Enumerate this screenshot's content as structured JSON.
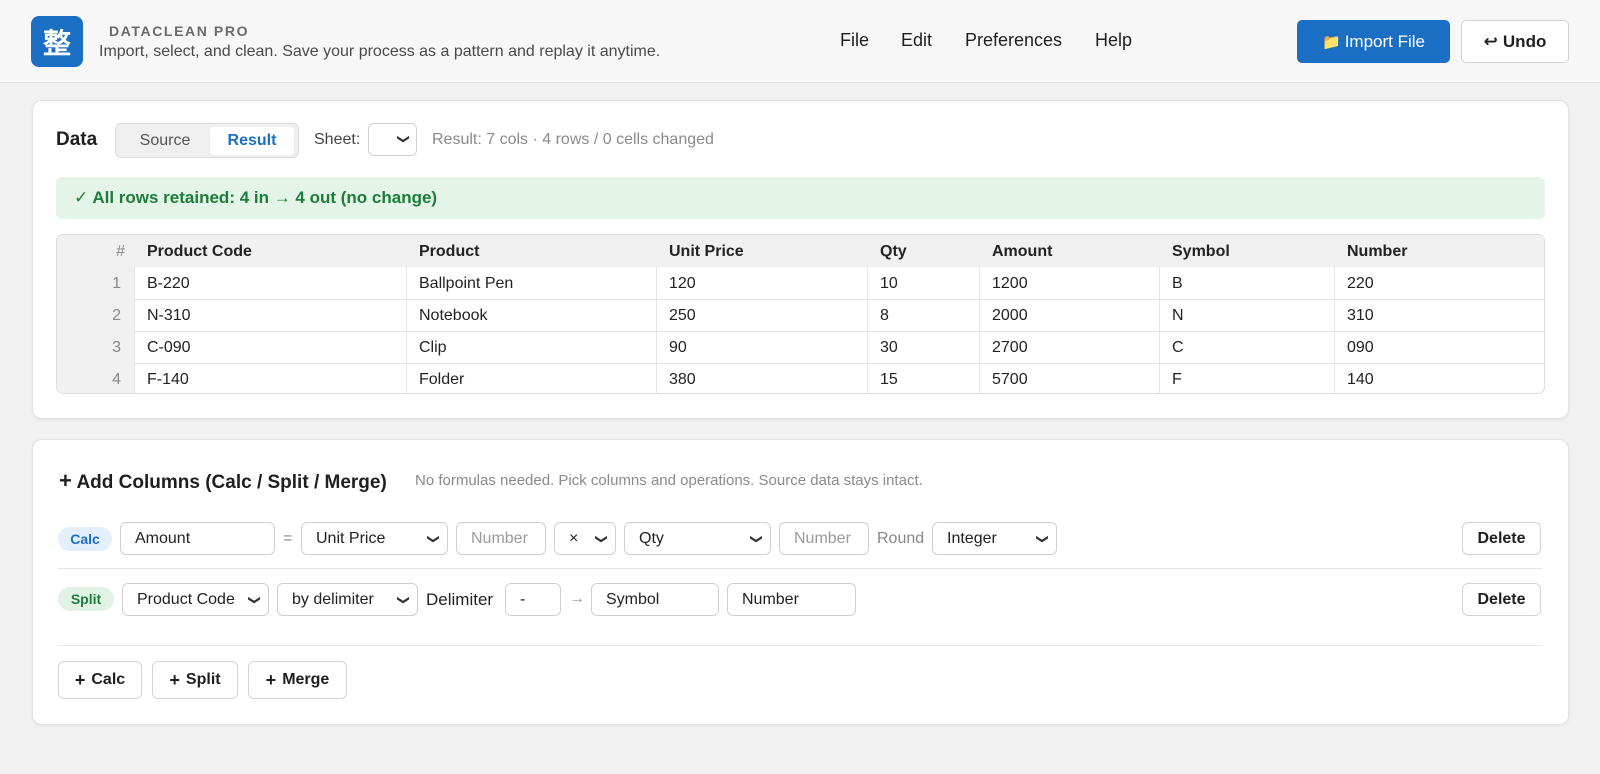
{
  "header": {
    "logo_glyph": "整",
    "brand": "DATACLEAN PRO",
    "tagline": "Import, select, and clean. Save your process as a pattern and replay it anytime.",
    "menu": {
      "file": "File",
      "edit": "Edit",
      "preferences": "Preferences",
      "help": "Help"
    },
    "import_icon": "📁",
    "import_label": "Import File",
    "undo_icon": "↩",
    "undo_label": "Undo",
    "accent_color": "#1a6fc4"
  },
  "data_panel": {
    "title": "Data",
    "view_tabs": {
      "source": "Source",
      "result": "Result",
      "active": "Result"
    },
    "sheet_label": "Sheet:",
    "sheet_value": "",
    "result_info": "Result: 7 cols · 4 rows / 0 cells changed",
    "banner": "✓ All rows retained: 4 in → 4 out (no change)",
    "table": {
      "columns": [
        "#",
        "Product Code",
        "Product",
        "Unit Price",
        "Qty",
        "Amount",
        "Symbol",
        "Number"
      ],
      "rows": [
        [
          "1",
          "B-220",
          "Ballpoint Pen",
          "120",
          "10",
          "1200",
          "B",
          "220"
        ],
        [
          "2",
          "N-310",
          "Notebook",
          "250",
          "8",
          "2000",
          "N",
          "310"
        ],
        [
          "3",
          "C-090",
          "Clip",
          "90",
          "30",
          "2700",
          "C",
          "090"
        ],
        [
          "4",
          "F-140",
          "Folder",
          "380",
          "15",
          "5700",
          "F",
          "140"
        ]
      ]
    }
  },
  "add_columns": {
    "title": "Add Columns (Calc / Split / Merge)",
    "description": "No formulas needed. Pick columns and operations. Source data stays intact.",
    "calc_rule": {
      "tag": "Calc",
      "output_name": "Amount",
      "equals": "=",
      "left_column": "Unit Price",
      "left_number_placeholder": "Number",
      "operator": "×",
      "right_column": "Qty",
      "right_number_placeholder": "Number",
      "round_label": "Round",
      "round_value": "Integer",
      "delete_label": "Delete"
    },
    "split_rule": {
      "tag": "Split",
      "source_column": "Product Code",
      "method": "by delimiter",
      "delimiter_label": "Delimiter",
      "delimiter_value": "-",
      "arrow": "→",
      "output_1": "Symbol",
      "output_2": "Number",
      "delete_label": "Delete"
    },
    "add_buttons": {
      "calc": "Calc",
      "split": "Split",
      "merge": "Merge",
      "plus": "+"
    }
  }
}
